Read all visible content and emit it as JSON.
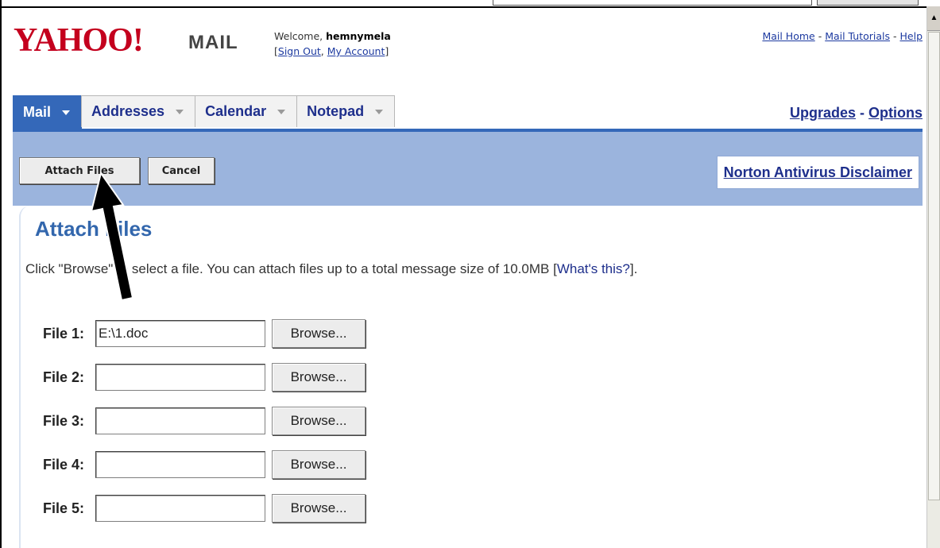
{
  "header": {
    "logo_text": "YAHOO!",
    "logo_mail": "MAIL",
    "welcome_prefix": "Welcome, ",
    "username": "hemnymela",
    "sign_out": "Sign Out",
    "my_account": "My Account",
    "links": [
      "Mail Home",
      "Mail Tutorials",
      "Help"
    ]
  },
  "tabs": [
    {
      "label": "Mail",
      "active": true
    },
    {
      "label": "Addresses",
      "active": false
    },
    {
      "label": "Calendar",
      "active": false
    },
    {
      "label": "Notepad",
      "active": false
    }
  ],
  "right_links": {
    "upgrades": "Upgrades",
    "options": "Options"
  },
  "toolbar": {
    "attach_label": "Attach Files",
    "cancel_label": "Cancel",
    "norton_label": "Norton Antivirus Disclaimer"
  },
  "main": {
    "title": "Attach Files",
    "description": "Click \"Browse\" to select a file. You can attach files up to a total message size of 10.0MB [",
    "whats_this": "What's this?",
    "description_end": "]."
  },
  "files": [
    {
      "label": "File 1:",
      "value": "E:\\1.doc",
      "browse": "Browse..."
    },
    {
      "label": "File 2:",
      "value": "",
      "browse": "Browse..."
    },
    {
      "label": "File 3:",
      "value": "",
      "browse": "Browse..."
    },
    {
      "label": "File 4:",
      "value": "",
      "browse": "Browse..."
    },
    {
      "label": "File 5:",
      "value": "",
      "browse": "Browse..."
    }
  ],
  "colors": {
    "brand_red": "#c4001e",
    "tab_active": "#3468b9",
    "toolbar_bg": "#9bb4dd",
    "link_blue": "#1e2f8c",
    "title_blue": "#3367ad"
  }
}
